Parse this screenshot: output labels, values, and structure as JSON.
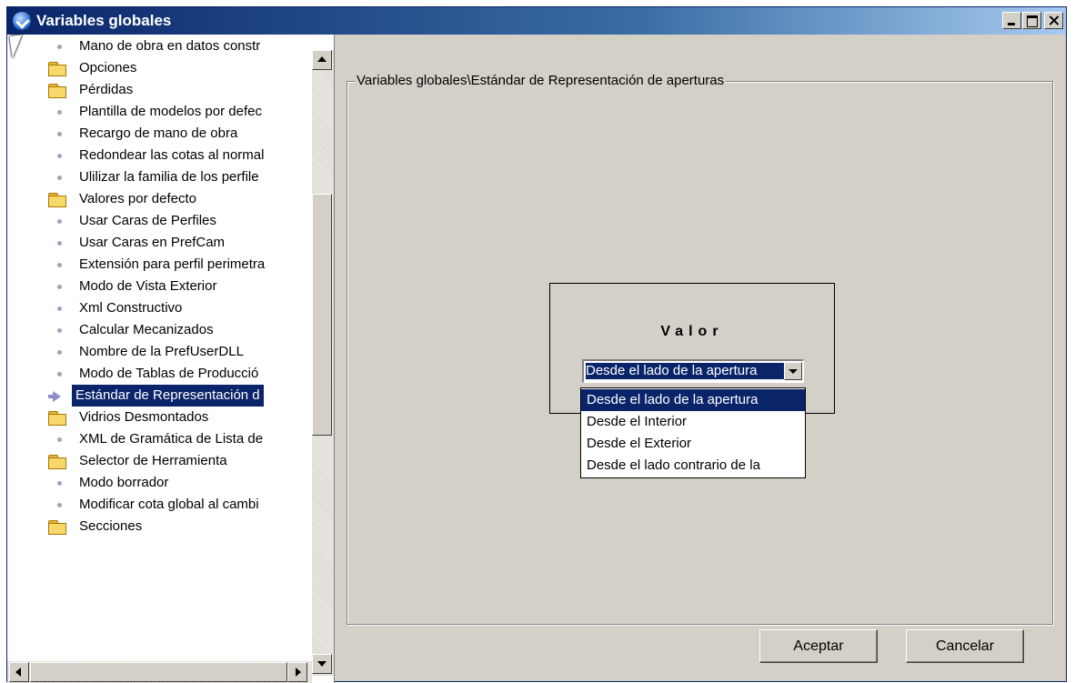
{
  "window": {
    "title": "Variables globales"
  },
  "tree": {
    "items": [
      {
        "label": "Mano de obra en datos constr",
        "icon": "bullet-icon"
      },
      {
        "label": "Opciones",
        "icon": "folder-icon"
      },
      {
        "label": "Pérdidas",
        "icon": "folder-icon"
      },
      {
        "label": "Plantilla de modelos por defec",
        "icon": "bullet-icon"
      },
      {
        "label": "Recargo de mano de obra",
        "icon": "bullet-icon"
      },
      {
        "label": "Redondear las cotas al normal",
        "icon": "bullet-icon"
      },
      {
        "label": "Ulilizar la familia de los perfile",
        "icon": "bullet-icon"
      },
      {
        "label": "Valores por defecto",
        "icon": "folder-icon"
      },
      {
        "label": "Usar Caras de Perfiles",
        "icon": "bullet-icon"
      },
      {
        "label": "Usar Caras en PrefCam",
        "icon": "bullet-icon"
      },
      {
        "label": "Extensión para perfil perimetra",
        "icon": "bullet-icon"
      },
      {
        "label": "Modo de Vista Exterior",
        "icon": "bullet-icon"
      },
      {
        "label": "Xml Constructivo",
        "icon": "bullet-icon"
      },
      {
        "label": "Calcular Mecanizados",
        "icon": "bullet-icon"
      },
      {
        "label": "Nombre de la PrefUserDLL",
        "icon": "bullet-icon"
      },
      {
        "label": "Modo de Tablas de Producció",
        "icon": "bullet-icon"
      },
      {
        "label": "Estándar de Representación d",
        "icon": "arrow-icon",
        "selected": true
      },
      {
        "label": "Vidrios Desmontados",
        "icon": "folder-icon"
      },
      {
        "label": "XML de Gramática de Lista de",
        "icon": "bullet-icon"
      },
      {
        "label": "Selector de Herramienta",
        "icon": "folder-icon"
      },
      {
        "label": "Modo borrador",
        "icon": "bullet-icon"
      },
      {
        "label": "Modificar cota global al cambi",
        "icon": "bullet-icon"
      },
      {
        "label": "Secciones",
        "icon": "folder-icon"
      }
    ]
  },
  "panel": {
    "group_label": "Variables globales\\Estándar de Representación de aperturas",
    "valor_label": "Valor",
    "combo_value": "Desde el lado de la apertura",
    "options": [
      "Desde el lado de la apertura",
      "Desde el Interior",
      "Desde el Exterior",
      "Desde el lado contrario de la"
    ]
  },
  "buttons": {
    "ok": "Aceptar",
    "cancel": "Cancelar"
  },
  "colors": {
    "selection": "#0a246a",
    "face": "#d4d0c8"
  }
}
